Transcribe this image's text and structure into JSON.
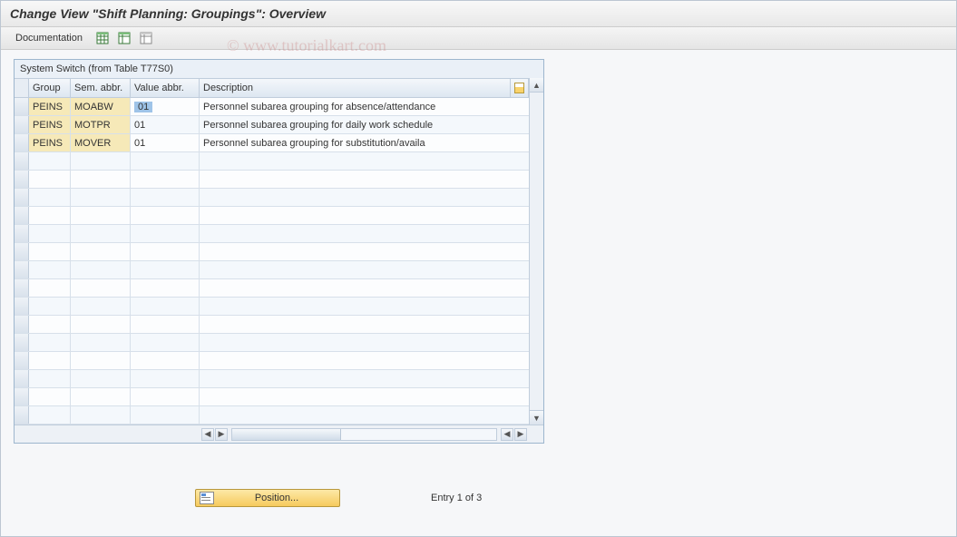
{
  "header": {
    "title": "Change View \"Shift Planning: Groupings\": Overview"
  },
  "toolbar": {
    "documentation_label": "Documentation"
  },
  "watermark": "© www.tutorialkart.com",
  "table": {
    "title": "System Switch (from Table T77S0)",
    "columns": {
      "group": "Group",
      "sem": "Sem. abbr.",
      "val": "Value abbr.",
      "desc": "Description"
    },
    "rows": [
      {
        "group": "PEINS",
        "sem": "MOABW",
        "val": "01",
        "desc": "Personnel subarea grouping for absence/attendance",
        "selected": true
      },
      {
        "group": "PEINS",
        "sem": "MOTPR",
        "val": "01",
        "desc": "Personnel subarea grouping for daily work schedule",
        "selected": false
      },
      {
        "group": "PEINS",
        "sem": "MOVER",
        "val": "01",
        "desc": "Personnel subarea grouping for substitution/availa",
        "selected": false
      }
    ]
  },
  "footer": {
    "position_label": "Position...",
    "entry_info": "Entry 1 of 3"
  }
}
